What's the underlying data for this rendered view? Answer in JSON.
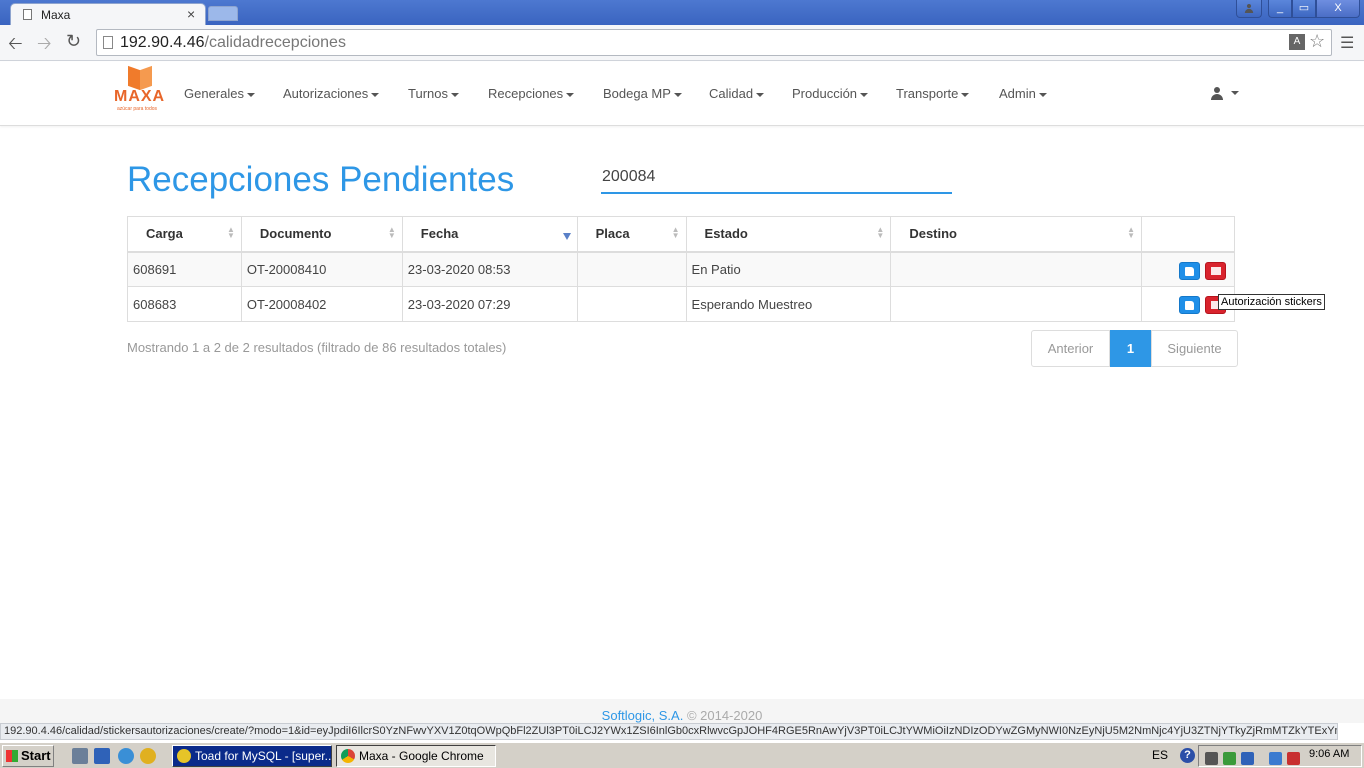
{
  "browser": {
    "tab_title": "Maxa",
    "tab_close": "×",
    "url_host": "192.90.4.46",
    "url_path": "/calidadrecepciones",
    "status_url": "192.90.4.46/calidad/stickersautorizaciones/create/?modo=1&id=eyJpdiI6IlcrS0YzNFwvYXV1Z0tqOWpQbFl2ZUl3PT0iLCJ2YWx1ZSI6InlGb0cxRlwvcGpJOHF4RGE5RnAwYjV3PT0iLCJtYWMiOiIzNDIzODYwZGMyNWI0NzEyNjU5M2NmNjc4YjU3ZTNjYTkyZjRmMTZkYTExYmYxYTA4ZjUz...",
    "window_buttons": {
      "min": "_",
      "max": "▭",
      "close": "X"
    },
    "icons": [
      "page-icon",
      "back-icon",
      "forward-icon",
      "reload-icon",
      "translate-icon",
      "star-icon",
      "menu-icon"
    ]
  },
  "app": {
    "logo_text": "MAXA",
    "logo_sub": "azúcar para todos",
    "menu": [
      "Generales",
      "Autorizaciones",
      "Turnos",
      "Recepciones",
      "Bodega MP",
      "Calidad",
      "Producción",
      "Transporte",
      "Admin"
    ],
    "brand_color": "#e8662a",
    "accent_color": "#2e97e6"
  },
  "page": {
    "title": "Recepciones Pendientes",
    "search_value": "200084"
  },
  "table": {
    "columns": [
      "Carga",
      "Documento",
      "Fecha",
      "Placa",
      "Estado",
      "Destino"
    ],
    "sorted_column": "Fecha",
    "sort_direction": "desc",
    "rows": [
      {
        "carga": "608691",
        "documento": "OT-20008410",
        "fecha": "23-03-2020 08:53",
        "placa": "",
        "estado": "En Patio",
        "destino": ""
      },
      {
        "carga": "608683",
        "documento": "OT-20008402",
        "fecha": "23-03-2020 07:29",
        "placa": "",
        "estado": "Esperando Muestreo",
        "destino": ""
      }
    ],
    "tooltip": "Autorización stickers",
    "info": "Mostrando 1 a 2 de 2 resultados (filtrado de 86 resultados totales)"
  },
  "pagination": {
    "previous": "Anterior",
    "current": "1",
    "next": "Siguiente"
  },
  "footer": {
    "company": "Softlogic, S.A.",
    "copyright": " © 2014-2020"
  },
  "taskbar": {
    "start": "Start",
    "tasks": [
      "Toad for MySQL - [super...",
      "Maxa - Google Chrome"
    ],
    "language": "ES",
    "help": "?",
    "time": "9:06 AM"
  }
}
